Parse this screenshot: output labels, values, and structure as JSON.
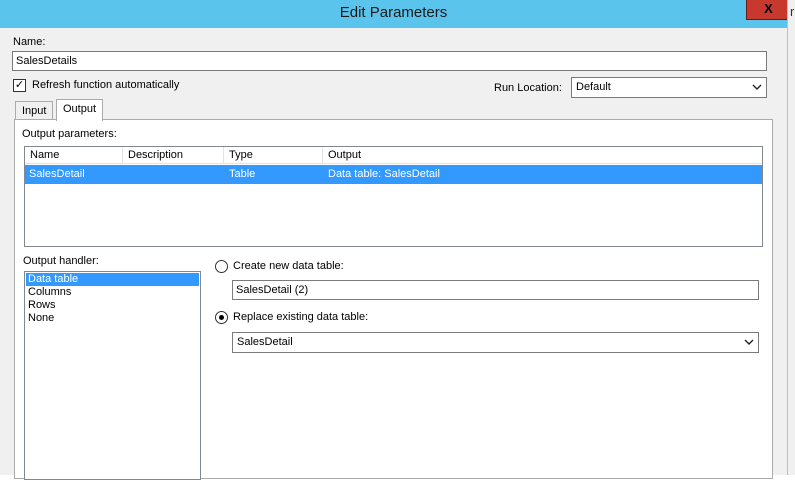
{
  "window": {
    "title": "Edit Parameters",
    "close_glyph": "X",
    "edge_char": "r"
  },
  "name": {
    "label": "Name:",
    "value": "SalesDetails"
  },
  "refresh": {
    "label": "Refresh function automatically",
    "checked": true,
    "check_glyph": "✓"
  },
  "run_location": {
    "label": "Run Location:",
    "value": "Default"
  },
  "tabs": [
    {
      "label": "Input",
      "active": false
    },
    {
      "label": "Output",
      "active": true
    }
  ],
  "output_parameters": {
    "label": "Output parameters:",
    "columns": [
      "Name",
      "Description",
      "Type",
      "Output"
    ],
    "rows": [
      {
        "name": "SalesDetail",
        "description": "",
        "type": "Table",
        "output": "Data table: SalesDetail"
      }
    ]
  },
  "output_handler": {
    "label": "Output handler:",
    "items": [
      "Data table",
      "Columns",
      "Rows",
      "None"
    ],
    "selected": "Data table"
  },
  "create_new": {
    "label": "Create new data table:",
    "value": "SalesDetail (2)",
    "selected": false
  },
  "replace_existing": {
    "label": "Replace existing data table:",
    "value": "SalesDetail",
    "selected": true
  },
  "icons": {
    "dropdown": "chevron-down-icon",
    "check": "checkmark-icon",
    "close": "close-icon"
  }
}
